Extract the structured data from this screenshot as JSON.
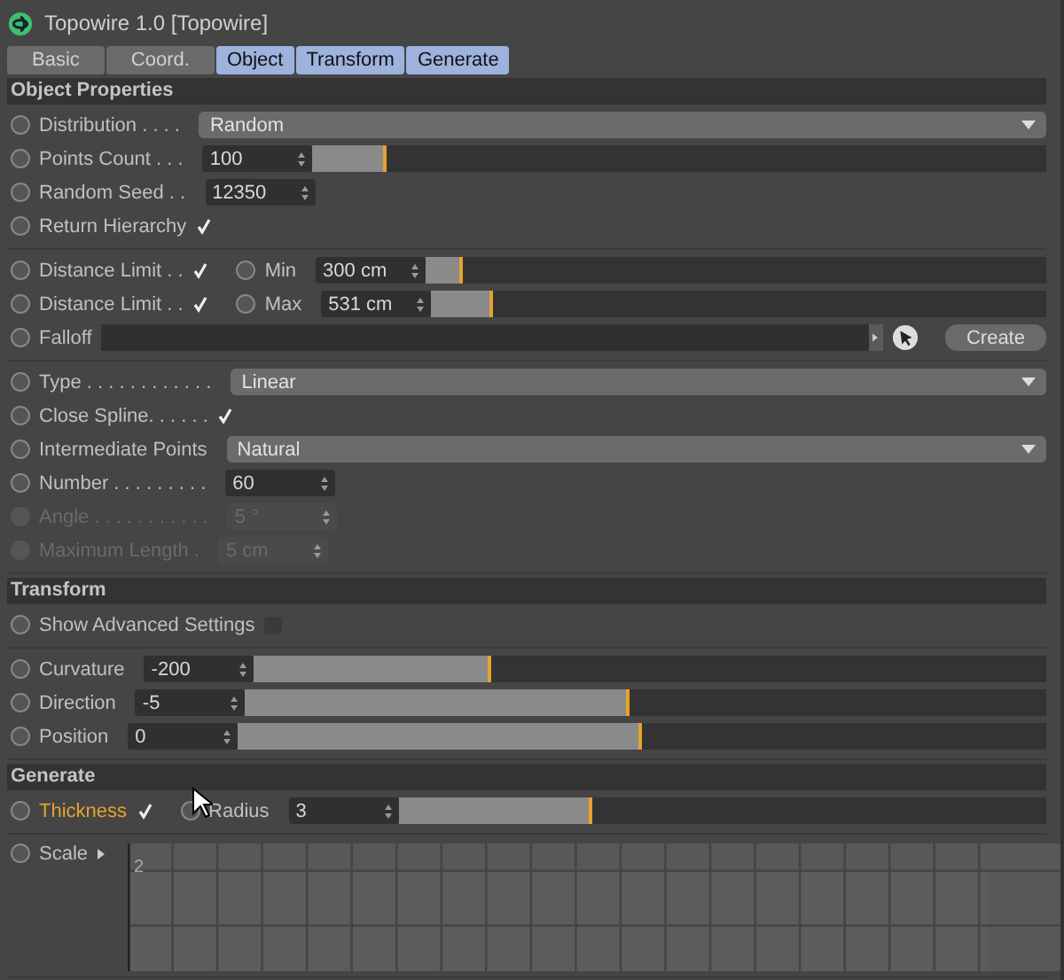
{
  "window": {
    "title": "Topowire 1.0 [Topowire]"
  },
  "tabs": [
    {
      "label": "Basic",
      "selected": false
    },
    {
      "label": "Coord.",
      "selected": false
    },
    {
      "label": "Object",
      "selected": true
    },
    {
      "label": "Transform",
      "selected": true
    },
    {
      "label": "Generate",
      "selected": true
    }
  ],
  "sections": [
    {
      "title": "Object Properties",
      "groups": [
        [
          {
            "kind": "dropdown",
            "label": "Distribution . . . .",
            "value": "Random"
          },
          {
            "kind": "slider",
            "label": "Points Count . . .",
            "value": "100",
            "level": 0.1
          },
          {
            "kind": "number",
            "label": "Random Seed . .",
            "value": "12350",
            "disabled": false
          },
          {
            "kind": "check",
            "label": "Return Hierarchy",
            "checked": true
          }
        ],
        [
          {
            "kind": "limit",
            "label": "Distance Limit . .",
            "checked": true,
            "sub_label": "Min",
            "value": "300 cm",
            "level": 0.06
          },
          {
            "kind": "limit",
            "label": "Distance Limit . .",
            "checked": true,
            "sub_label": "Max",
            "value": "531 cm",
            "level": 0.1
          },
          {
            "kind": "link",
            "label": "Falloff",
            "button": "Create"
          }
        ],
        [
          {
            "kind": "dropdown",
            "label": "Type . . . . . . . . . . . .",
            "value": "Linear"
          },
          {
            "kind": "check",
            "label": "Close Spline. . . . . .",
            "checked": true
          },
          {
            "kind": "dropdown",
            "label": "Intermediate Points",
            "value": "Natural"
          },
          {
            "kind": "number",
            "label": "Number . . . . . . . . .",
            "value": "60",
            "disabled": false
          },
          {
            "kind": "number",
            "label": "Angle . . . . . . . . . . .",
            "value": "5 °",
            "disabled": true
          },
          {
            "kind": "number",
            "label": "Maximum Length .",
            "value": "5 cm",
            "disabled": true
          }
        ]
      ]
    },
    {
      "title": "Transform",
      "groups": [
        [
          {
            "kind": "check",
            "label": "Show Advanced Settings",
            "checked": false
          }
        ],
        [
          {
            "kind": "slider",
            "label": "Curvature",
            "value": "-200",
            "level": 0.3
          },
          {
            "kind": "slider",
            "label": "Direction",
            "value": "-5",
            "level": 0.48
          },
          {
            "kind": "slider",
            "label": "Position",
            "value": "0",
            "level": 0.5
          }
        ]
      ]
    },
    {
      "title": "Generate",
      "groups": [
        [
          {
            "kind": "check-slider",
            "label": "Thickness",
            "keyed": true,
            "checked": true,
            "sub_label": "Radius",
            "value": "3",
            "level": 0.3
          }
        ],
        [
          {
            "kind": "spline",
            "label": "Scale",
            "axis_label": "2"
          }
        ]
      ]
    }
  ]
}
